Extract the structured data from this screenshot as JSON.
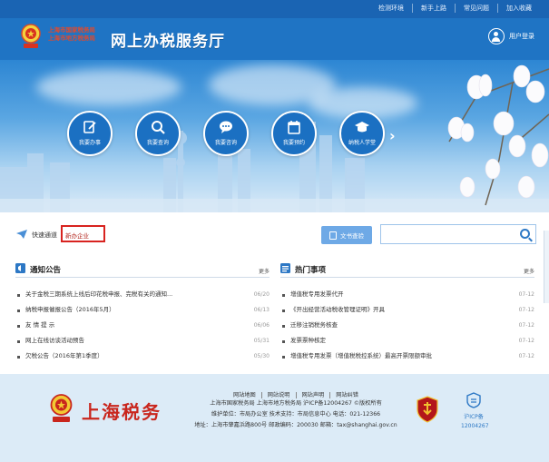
{
  "topbar": {
    "links": [
      "检测环境",
      "新手上路",
      "常见问题",
      "加入收藏"
    ]
  },
  "header": {
    "bureau_lines": [
      "上海市国家税务局",
      "上海市地方税务局"
    ],
    "site_title": "网上办税服务厅",
    "login_label": "用户登录"
  },
  "banner": {
    "services": [
      {
        "label": "我要办事",
        "icon": "edit-icon"
      },
      {
        "label": "我要查询",
        "icon": "search-icon"
      },
      {
        "label": "我要咨询",
        "icon": "chat-icon"
      },
      {
        "label": "我要预约",
        "icon": "calendar-icon"
      },
      {
        "label": "纳税人学堂",
        "icon": "graduation-cap-icon"
      }
    ],
    "next_arrow": "›"
  },
  "quick": {
    "label": "快速通道",
    "selected": "新办企业",
    "doc_button": "文书查验"
  },
  "notices": {
    "title": "通知公告",
    "more": "更多",
    "items": [
      {
        "text": "关于金税三期系统上线后印花税申报、完税有关的通知...",
        "date": "06/20"
      },
      {
        "text": "纳税申报催报公告（2016年5月）",
        "date": "06/13"
      },
      {
        "text": "友 情 提 示",
        "date": "06/06"
      },
      {
        "text": "网上在线访谈活动预告",
        "date": "05/31"
      },
      {
        "text": "欠税公告（2016年第1季度）",
        "date": "05/30"
      }
    ]
  },
  "hot": {
    "title": "热门事项",
    "more": "更多",
    "items": [
      {
        "text": "增值税专用发票代开",
        "date": "07-12"
      },
      {
        "text": "《开出经营活动税收管理证明》开具",
        "date": "07-12"
      },
      {
        "text": "迁移注销税务核查",
        "date": "07-12"
      },
      {
        "text": "发票票种核定",
        "date": "07-12"
      },
      {
        "text": "增值税专用发票（增值税税控系统）最高开票限额审批",
        "date": "07-12"
      }
    ]
  },
  "footer": {
    "logo_text": "上海税务",
    "links": [
      "网站地图",
      "网站说明",
      "网站声明",
      "网站纠错"
    ],
    "lines": [
      "上海市国家税务局  上海市地方税务局  沪ICP备12004267  ©版权所有",
      "维护单位：市局办公室   技术支持：市局信息中心 电话：021-12366",
      "地址：上海市肇嘉浜路800号    邮政编码：200030    邮箱：tax@shanghai.gov.cn"
    ],
    "icp_badge_top": "沪ICP备",
    "icp_badge_num": "12004267"
  },
  "colors": {
    "primary": "#1f74c4",
    "topbar": "#1a64b3",
    "highlight": "#d8231f",
    "footer_bg": "#dcebf7"
  }
}
